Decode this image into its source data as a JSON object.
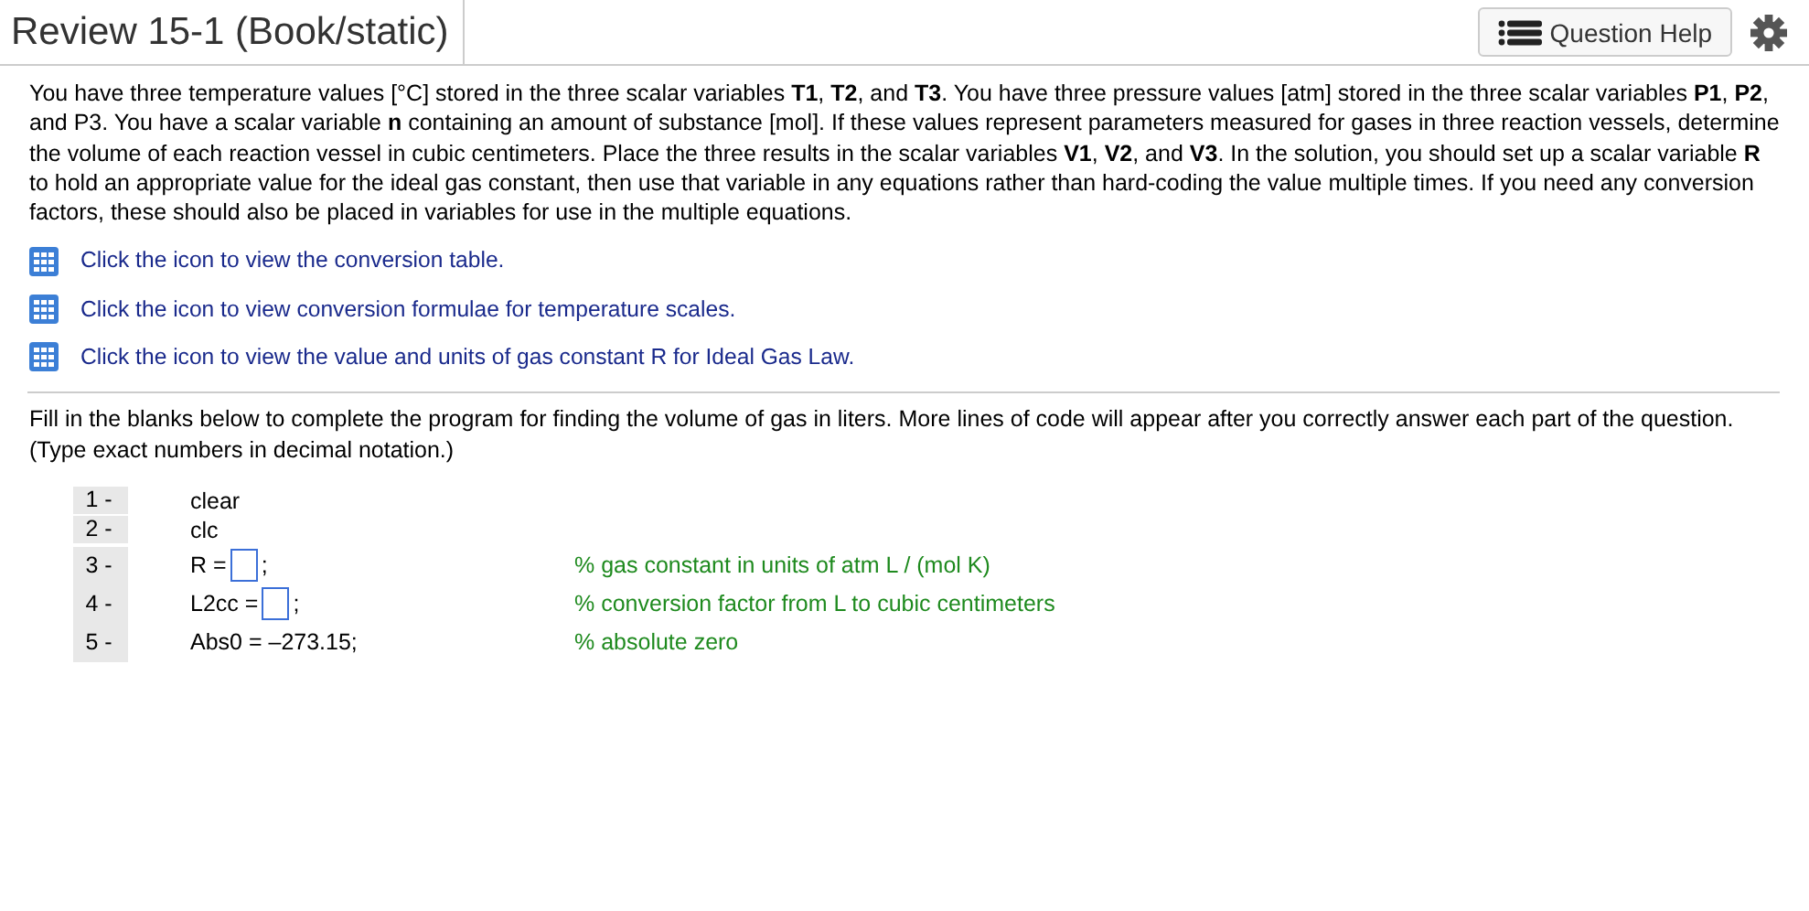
{
  "header": {
    "title": "Review 15-1 (Book/static)",
    "help_button": "Question Help"
  },
  "problem": "You have three temperature values [°C] stored in the three scalar variables **T1**, **T2**, and **T3**. You have three pressure values [atm] stored in the three scalar variables **P1**, **P2**, and P3. You have a scalar variable **n** containing an amount of substance [mol]. If these values represent parameters measured for gases in three reaction vessels, determine the volume of each reaction vessel in cubic centimeters. Place the three results in the scalar variables **V1**, **V2**, and **V3**. In the solution, you should set up a scalar variable **R** to hold an appropriate value for the ideal gas constant, then use that variable in any equations rather than hard-coding the value multiple times. If you need any conversion factors, these should also be placed in variables for use in the multiple equations.",
  "resource_links": [
    "Click the icon to view the conversion table.",
    "Click the icon to view conversion formulae for temperature scales.",
    "Click the icon to view the value and units of gas constant R for Ideal Gas Law."
  ],
  "instructions": "Fill in the blanks below to complete the program for finding the volume of gas in liters. More lines of code will appear after you correctly answer each part of the question. (Type exact numbers in decimal notation.)",
  "code_lines": [
    {
      "number": "1 -",
      "parts": [
        {
          "kind": "text",
          "text": "clear"
        }
      ]
    },
    {
      "number": "2 -",
      "parts": [
        {
          "kind": "text",
          "text": "clc"
        }
      ]
    },
    {
      "number": "3 -",
      "parts": [
        {
          "kind": "text",
          "text": "R ="
        },
        {
          "kind": "blank"
        },
        {
          "kind": "text",
          "text": ";"
        }
      ],
      "comment": "% gas constant in units of atm L / (mol K)"
    },
    {
      "number": "4 -",
      "parts": [
        {
          "kind": "text",
          "text": "L2cc ="
        },
        {
          "kind": "blank"
        },
        {
          "kind": "text",
          "text": ";"
        }
      ],
      "comment": "% conversion factor from L to cubic centimeters"
    },
    {
      "number": "5 -",
      "parts": [
        {
          "kind": "text",
          "text": "Abs0 = –273.15;"
        }
      ],
      "comment": "% absolute zero"
    }
  ]
}
